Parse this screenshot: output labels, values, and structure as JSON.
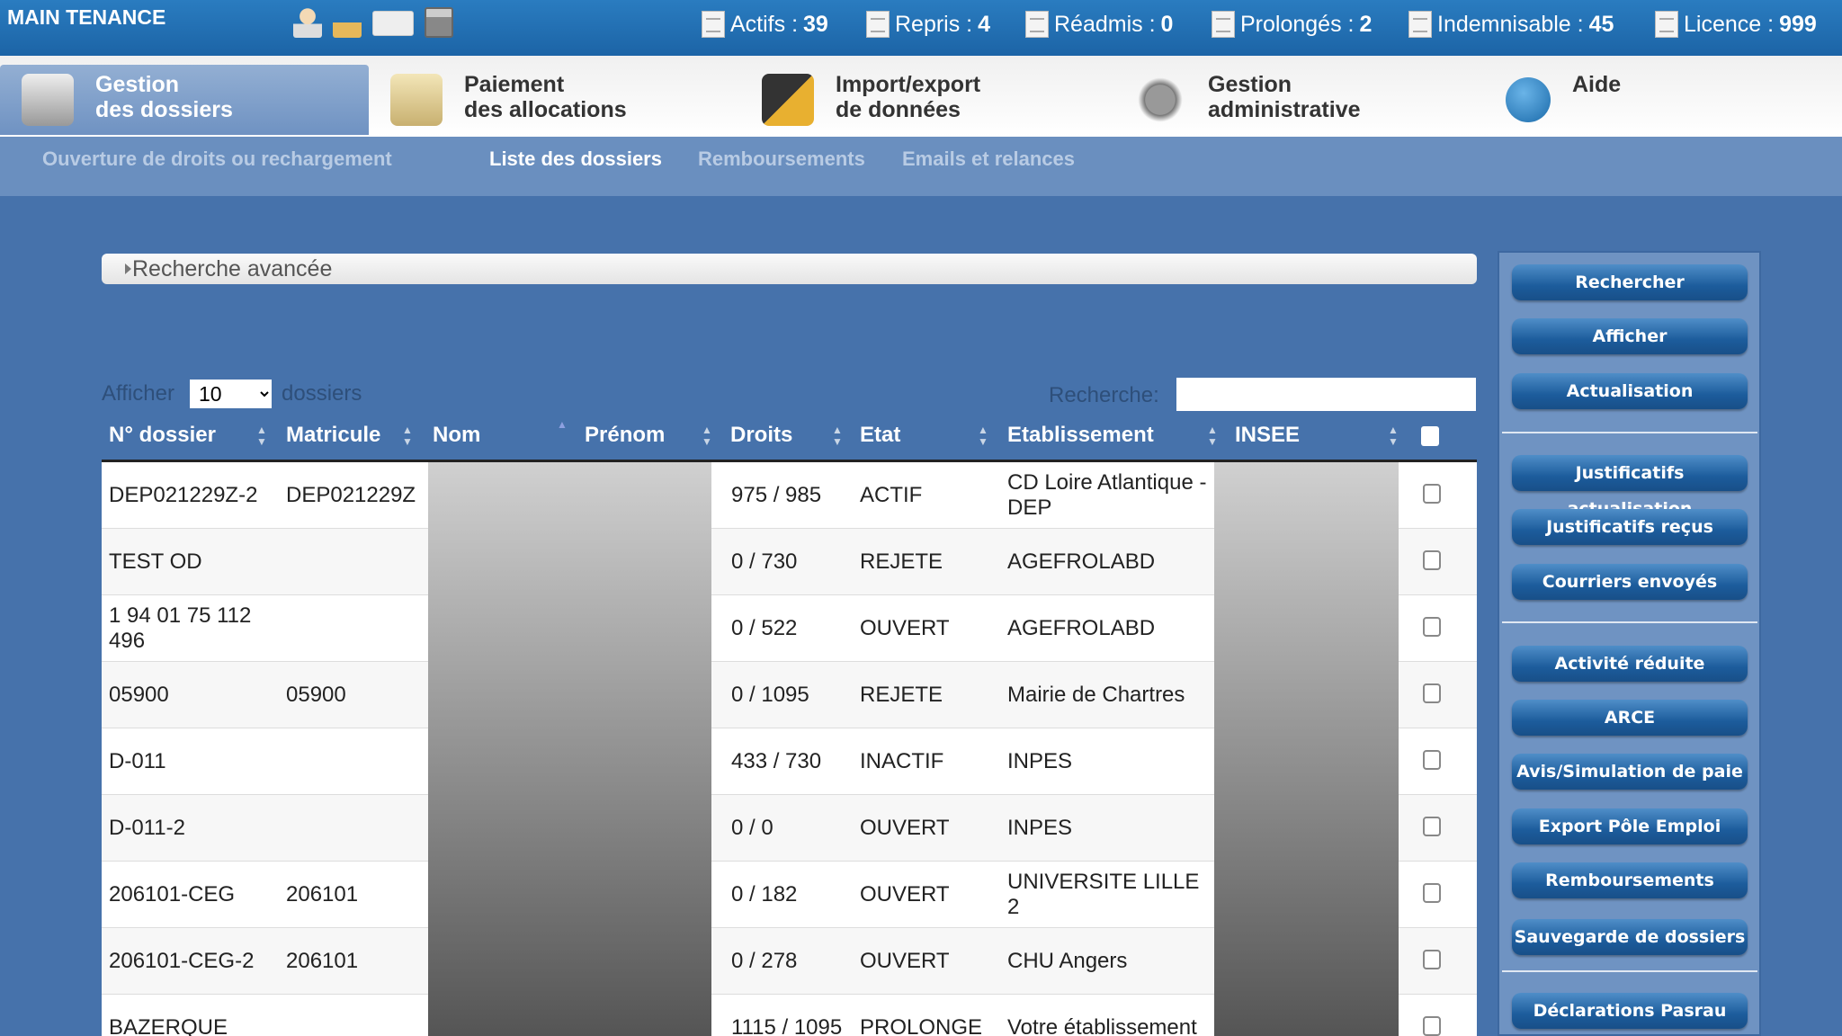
{
  "app_title": "MAIN TENANCE",
  "top_icons": [
    "user-icon",
    "tools-icon",
    "mail-icon",
    "calculator-icon"
  ],
  "stats": [
    {
      "label": "Actifs : ",
      "value": "39",
      "icon": "document-icon"
    },
    {
      "label": "Repris : ",
      "value": "4",
      "icon": "document-return-icon"
    },
    {
      "label": "Réadmis : ",
      "value": "0",
      "icon": "document-error-icon"
    },
    {
      "label": "Prolongés : ",
      "value": "2",
      "icon": "document-arrow-icon"
    },
    {
      "label": "Indemnisable : ",
      "value": "45",
      "icon": "document-check-icon"
    },
    {
      "label": "Licence : ",
      "value": "999",
      "icon": "license-icon"
    }
  ],
  "main_nav": [
    {
      "line1": "Gestion",
      "line2": "des dossiers",
      "icon": "filing-cabinet-icon",
      "active": true
    },
    {
      "line1": "Paiement",
      "line2": "des allocations",
      "icon": "money-icon"
    },
    {
      "line1": "Import/export",
      "line2": "de données",
      "icon": "disk-pencil-icon"
    },
    {
      "line1": "Gestion",
      "line2": "administrative",
      "icon": "gears-icon"
    },
    {
      "line1": "Aide",
      "line2": "",
      "icon": "help-icon"
    }
  ],
  "sub_nav": [
    "Ouverture de droits ou rechargement",
    "Liste des dossiers",
    "Remboursements",
    "Emails et relances"
  ],
  "sub_nav_current": "Liste des dossiers",
  "advanced_search": "Recherche avancée",
  "length": {
    "prefix": "Afficher",
    "value": "10",
    "suffix": "dossiers"
  },
  "search": {
    "label": "Recherche:",
    "value": ""
  },
  "columns": [
    "N° dossier",
    "Matricule",
    "Nom",
    "Prénom",
    "Droits",
    "Etat",
    "Etablissement",
    "INSEE"
  ],
  "rows": [
    {
      "dossier": "DEP021229Z-2",
      "matricule": "DEP021229Z",
      "droits": "975 / 985",
      "etat": "ACTIF",
      "etab": "CD Loire Atlantique - DEP"
    },
    {
      "dossier": "TEST OD",
      "matricule": "",
      "droits": "0 / 730",
      "etat": "REJETE",
      "etab": "AGEFROLABD"
    },
    {
      "dossier": "1 94 01 75 112 496",
      "matricule": "",
      "droits": "0 / 522",
      "etat": "OUVERT",
      "etab": "AGEFROLABD"
    },
    {
      "dossier": "05900",
      "matricule": "05900",
      "droits": "0 / 1095",
      "etat": "REJETE",
      "etab": "Mairie de Chartres"
    },
    {
      "dossier": "D-011",
      "matricule": "",
      "droits": "433 / 730",
      "etat": "INACTIF",
      "etab": "INPES"
    },
    {
      "dossier": "D-011-2",
      "matricule": "",
      "droits": "0 / 0",
      "etat": "OUVERT",
      "etab": "INPES"
    },
    {
      "dossier": "206101-CEG",
      "matricule": "206101",
      "droits": "0 / 182",
      "etat": "OUVERT",
      "etab": "UNIVERSITE LILLE 2"
    },
    {
      "dossier": "206101-CEG-2",
      "matricule": "206101",
      "droits": "0 / 278",
      "etat": "OUVERT",
      "etab": "CHU Angers"
    },
    {
      "dossier": "BAZERQUE",
      "matricule": "",
      "droits": "1115 / 1095",
      "etat": "PROLONGE",
      "etab": "Votre établissement"
    }
  ],
  "actions": [
    [
      "Rechercher",
      "Afficher",
      "Actualisation"
    ],
    [
      "Justificatifs actualisation",
      "Justificatifs reçus",
      "Courriers envoyés"
    ],
    [
      "Activité réduite",
      "ARCE",
      "Avis/Simulation de paie",
      "Export Pôle Emploi",
      "Remboursements",
      "Sauvegarde de dossiers"
    ],
    [
      "Déclarations Pasrau"
    ]
  ]
}
